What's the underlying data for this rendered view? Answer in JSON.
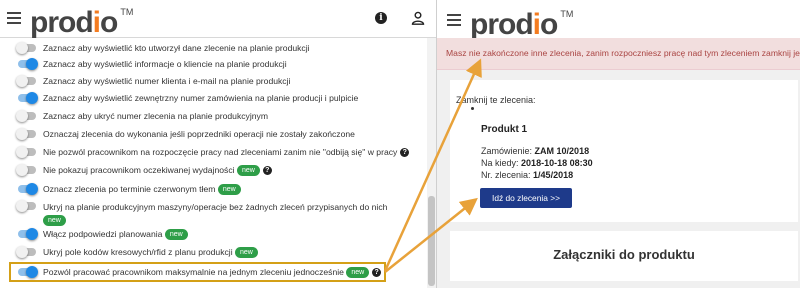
{
  "brand": {
    "name_pre": "prod",
    "name_accent": "i",
    "name_post": "o",
    "tm": "TM",
    "accent_color": "#f47c20"
  },
  "left_panel": {
    "options": [
      {
        "label": "Zaznacz aby wyświetlić kto utworzył dane zlecenie na planie produkcji",
        "on": false,
        "badge": "",
        "help": false
      },
      {
        "label": "Zaznacz aby wyświetlić informacje o kliencie na planie produkcji",
        "on": true,
        "badge": "",
        "help": false
      },
      {
        "label": "Zaznacz aby wyświetlić numer klienta i e-mail na planie produkcji",
        "on": false,
        "badge": "",
        "help": false
      },
      {
        "label": "Zaznacz aby wyświetlić zewnętrzny numer zamówienia na planie producji i pulpicie",
        "on": true,
        "badge": "",
        "help": false
      },
      {
        "label": "Zaznacz aby ukryć numer zlecenia na planie produkcyjnym",
        "on": false,
        "badge": "",
        "help": false
      },
      {
        "label": "Oznaczaj zlecenia do wykonania jeśli poprzedniki operacji nie zostały zakończone",
        "on": false,
        "badge": "",
        "help": false
      },
      {
        "label": "Nie pozwól pracownikom na rozpoczęcie pracy nad zleceniami zanim nie \"odbiją się\" w pracy",
        "on": false,
        "badge": "",
        "help": true
      },
      {
        "label": "Nie pokazuj pracownikom oczekiwanej wydajności",
        "on": false,
        "badge": "new",
        "help": true
      },
      {
        "label": "Oznacz zlecenia po terminie czerwonym tłem",
        "on": true,
        "badge": "new",
        "help": false
      },
      {
        "label": "Ukryj na planie produkcyjnym maszyny/operacje bez żadnych zleceń przypisanych do nich",
        "on": false,
        "badge": "new",
        "help": false
      },
      {
        "label": "Włącz podpowiedzi planowania",
        "on": true,
        "badge": "new",
        "help": false
      },
      {
        "label": "Ukryj pole kodów kresowych/rfid z planu produkcji",
        "on": false,
        "badge": "new",
        "help": false
      },
      {
        "label": "Pozwól pracować pracownikom maksymalnie na jednym zleceniu jednocześnie",
        "on": true,
        "badge": "new",
        "help": true
      }
    ]
  },
  "right_panel": {
    "alert": "Masz nie zakończone inne zlecenia, zanim rozpoczniesz pracę nad tym zleceniem zamknij je",
    "close_label": "Zamknij te zlecenia:",
    "product": "Produkt 1",
    "order_label": "Zamówienie:",
    "order_value": "ZAM 10/2018",
    "due_label": "Na kiedy:",
    "due_value": "2018-10-18 08:30",
    "number_label": "Nr. zlecenia:",
    "number_value": "1/45/2018",
    "go_button": "Idź do zlecenia >>",
    "attachments_title": "Załączniki do produktu"
  },
  "colors": {
    "toggle_on": "#1e88e5",
    "badge": "#2e9e48",
    "highlight": "#d4a017",
    "alert_bg": "#f2dede",
    "alert_text": "#a94442",
    "button": "#1e3a8a"
  },
  "icons": [
    "menu-icon",
    "info-icon",
    "user-icon",
    "help-icon"
  ]
}
